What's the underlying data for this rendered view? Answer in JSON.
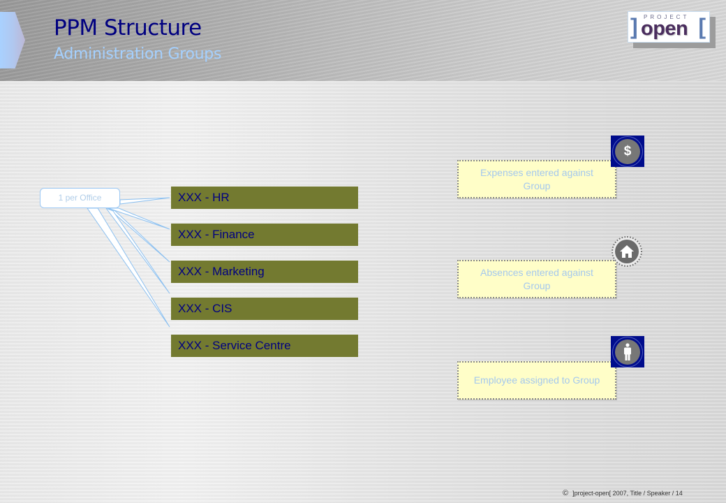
{
  "header": {
    "title": "PPM Structure",
    "subtitle": "Administration Groups",
    "logo": {
      "top_text": "PROJECT",
      "main_text": "open",
      "left_bracket": "]",
      "right_bracket": "["
    }
  },
  "diagram": {
    "callout": "1 per Office",
    "groups": [
      {
        "label": "XXX - HR"
      },
      {
        "label": "XXX - Finance"
      },
      {
        "label": "XXX - Marketing"
      },
      {
        "label": "XXX - CIS"
      },
      {
        "label": "XXX - Service Centre"
      }
    ],
    "notes": [
      {
        "text": "Expenses entered against Group",
        "icon": "dollar-icon"
      },
      {
        "text": "Absences entered against Group",
        "icon": "house-icon"
      },
      {
        "text": "Employee assigned to Group",
        "icon": "person-icon"
      }
    ],
    "icon_glyphs": {
      "dollar": "$"
    }
  },
  "colors": {
    "title": "#000080",
    "subtitle": "#a4d0ff",
    "group_bar": "#737a30",
    "group_text": "#000080",
    "note_bg": "#fffec8",
    "note_text": "#a4c8ee",
    "icon_bg": "#000c8c"
  },
  "footer": {
    "copyright_symbol": "©",
    "text": "]project-open[  2007, Title / Speaker / 14"
  }
}
